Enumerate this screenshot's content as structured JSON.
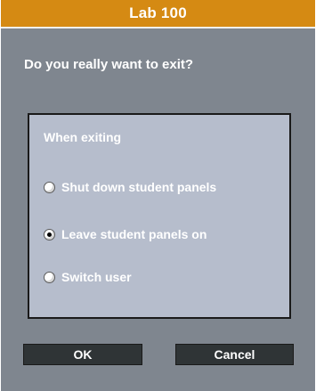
{
  "dialog": {
    "title": "Lab 100",
    "question": "Do you really want to exit?",
    "group": {
      "title": "When exiting",
      "options": [
        {
          "label": "Shut down student panels",
          "checked": false
        },
        {
          "label": "Leave student panels on",
          "checked": true
        },
        {
          "label": "Switch user",
          "checked": false
        }
      ]
    },
    "buttons": {
      "ok_label": "OK",
      "cancel_label": "Cancel"
    }
  },
  "colors": {
    "titlebar": "#d58a13",
    "dialog_background": "#7f868f",
    "group_background": "#b6bdcc",
    "button_background": "#2f3436"
  }
}
